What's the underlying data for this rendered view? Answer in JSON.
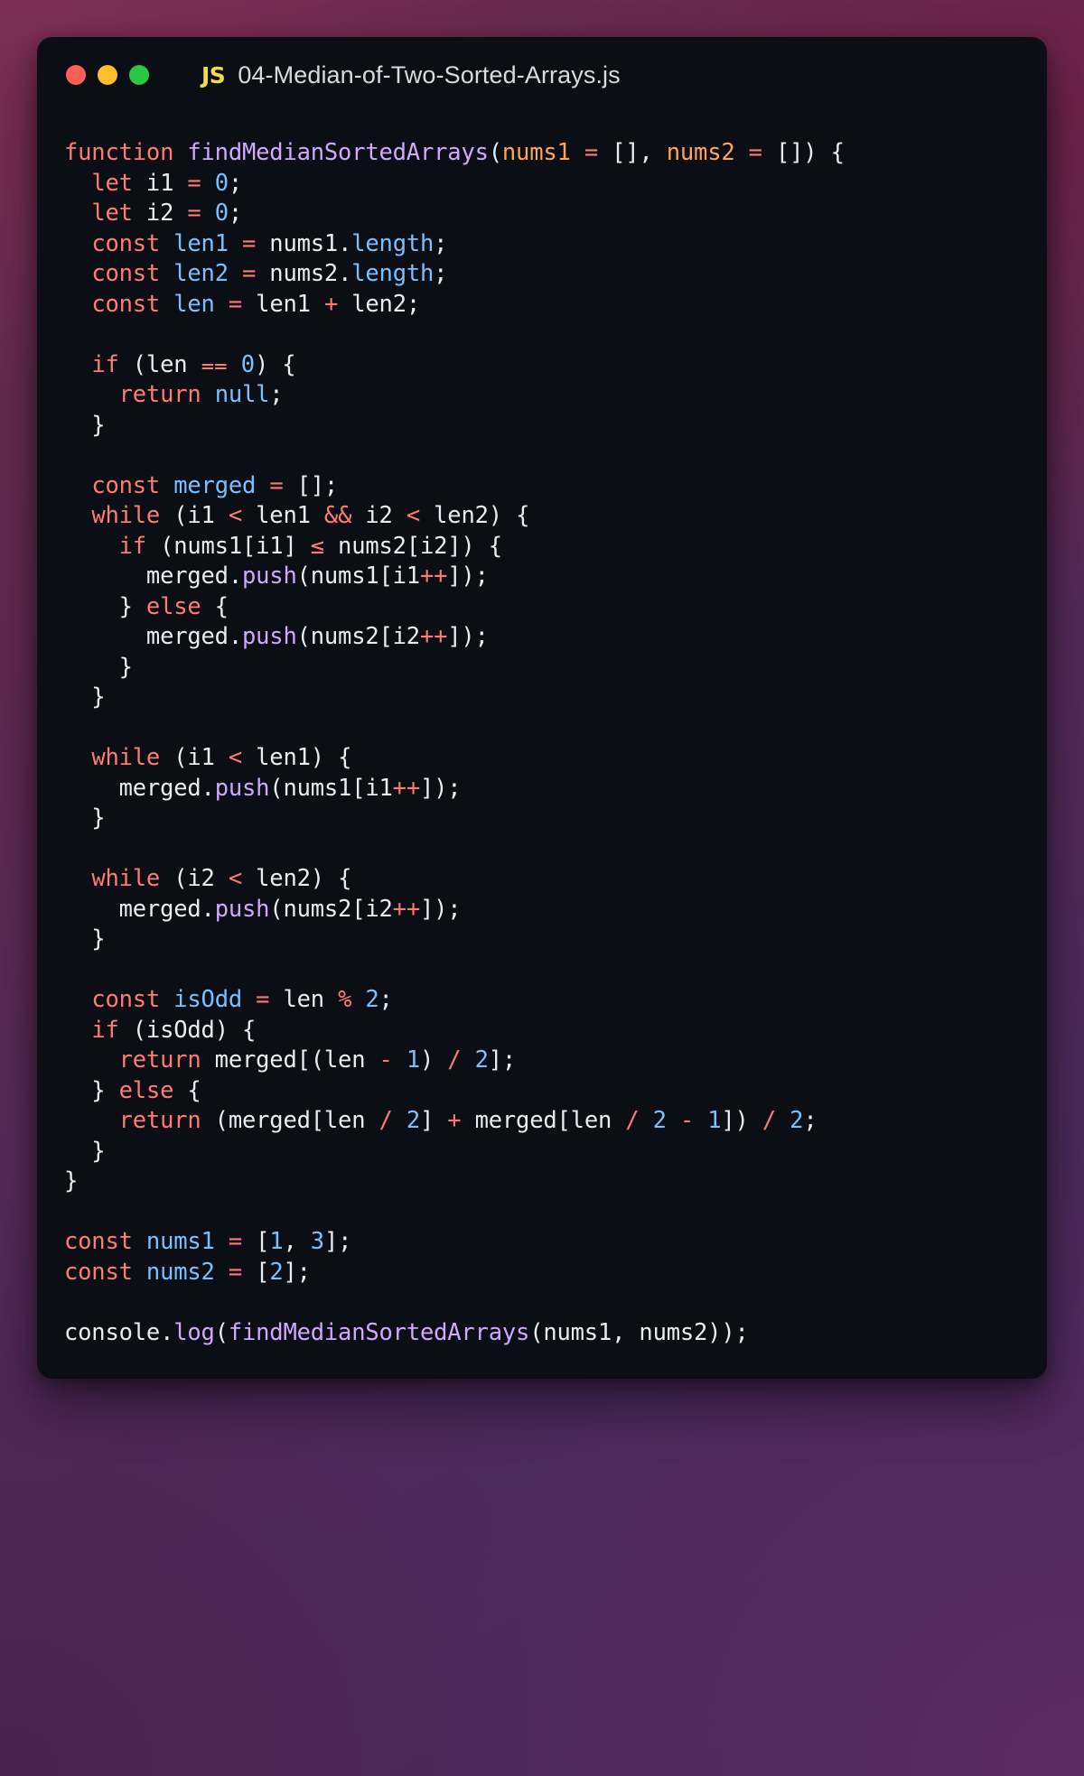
{
  "window": {
    "title": "04-Median-of-Two-Sorted-Arrays.js",
    "language_badge": "JS",
    "traffic_lights": [
      {
        "name": "close",
        "color": "#ff5f57"
      },
      {
        "name": "minimize",
        "color": "#febc2e"
      },
      {
        "name": "maximize",
        "color": "#28c840"
      }
    ]
  },
  "theme": {
    "background_card": "#0b0e14",
    "keyword": "#ff7b72",
    "function": "#d2a8ff",
    "variable": "#79c0ff",
    "parameter": "#ffa657",
    "number": "#79c0ff",
    "operator": "#ff7b72",
    "plain": "#e6edf3",
    "title_text": "#d7dae0",
    "js_badge": "#f0db4f"
  },
  "code": {
    "language": "javascript",
    "plain_text": "function findMedianSortedArrays(nums1 = [], nums2 = []) {\n  let i1 = 0;\n  let i2 = 0;\n  const len1 = nums1.length;\n  const len2 = nums2.length;\n  const len = len1 + len2;\n\n  if (len === 0) {\n    return null;\n  }\n\n  const merged = [];\n  while (i1 < len1 && i2 < len2) {\n    if (nums1[i1] <= nums2[i2]) {\n      merged.push(nums1[i1++]);\n    } else {\n      merged.push(nums2[i2++]);\n    }\n  }\n\n  while (i1 < len1) {\n    merged.push(nums1[i1++]);\n  }\n\n  while (i2 < len2) {\n    merged.push(nums2[i2++]);\n  }\n\n  const isOdd = len % 2;\n  if (isOdd) {\n    return merged[(len - 1) / 2];\n  } else {\n    return (merged[len / 2] + merged[len / 2 - 1]) / 2;\n  }\n}\n\nconst nums1 = [1, 3];\nconst nums2 = [2];\n\nconsole.log(findMedianSortedArrays(nums1, nums2));",
    "lines": [
      {
        "n": 1,
        "tokens": [
          {
            "t": "function",
            "c": "kw"
          },
          {
            "t": " ",
            "c": "pl"
          },
          {
            "t": "findMedianSortedArrays",
            "c": "fn"
          },
          {
            "t": "(",
            "c": "pl"
          },
          {
            "t": "nums1",
            "c": "par"
          },
          {
            "t": " ",
            "c": "pl"
          },
          {
            "t": "=",
            "c": "op"
          },
          {
            "t": " [], ",
            "c": "pl"
          },
          {
            "t": "nums2",
            "c": "par"
          },
          {
            "t": " ",
            "c": "pl"
          },
          {
            "t": "=",
            "c": "op"
          },
          {
            "t": " []) {",
            "c": "pl"
          }
        ]
      },
      {
        "n": 2,
        "tokens": [
          {
            "t": "  ",
            "c": "pl"
          },
          {
            "t": "let",
            "c": "kw"
          },
          {
            "t": " i1 ",
            "c": "pl"
          },
          {
            "t": "=",
            "c": "op"
          },
          {
            "t": " ",
            "c": "pl"
          },
          {
            "t": "0",
            "c": "num"
          },
          {
            "t": ";",
            "c": "pl"
          }
        ]
      },
      {
        "n": 3,
        "tokens": [
          {
            "t": "  ",
            "c": "pl"
          },
          {
            "t": "let",
            "c": "kw"
          },
          {
            "t": " i2 ",
            "c": "pl"
          },
          {
            "t": "=",
            "c": "op"
          },
          {
            "t": " ",
            "c": "pl"
          },
          {
            "t": "0",
            "c": "num"
          },
          {
            "t": ";",
            "c": "pl"
          }
        ]
      },
      {
        "n": 4,
        "tokens": [
          {
            "t": "  ",
            "c": "pl"
          },
          {
            "t": "const",
            "c": "kw"
          },
          {
            "t": " ",
            "c": "pl"
          },
          {
            "t": "len1",
            "c": "var"
          },
          {
            "t": " ",
            "c": "pl"
          },
          {
            "t": "=",
            "c": "op"
          },
          {
            "t": " nums1.",
            "c": "pl"
          },
          {
            "t": "length",
            "c": "var"
          },
          {
            "t": ";",
            "c": "pl"
          }
        ]
      },
      {
        "n": 5,
        "tokens": [
          {
            "t": "  ",
            "c": "pl"
          },
          {
            "t": "const",
            "c": "kw"
          },
          {
            "t": " ",
            "c": "pl"
          },
          {
            "t": "len2",
            "c": "var"
          },
          {
            "t": " ",
            "c": "pl"
          },
          {
            "t": "=",
            "c": "op"
          },
          {
            "t": " nums2.",
            "c": "pl"
          },
          {
            "t": "length",
            "c": "var"
          },
          {
            "t": ";",
            "c": "pl"
          }
        ]
      },
      {
        "n": 6,
        "tokens": [
          {
            "t": "  ",
            "c": "pl"
          },
          {
            "t": "const",
            "c": "kw"
          },
          {
            "t": " ",
            "c": "pl"
          },
          {
            "t": "len",
            "c": "var"
          },
          {
            "t": " ",
            "c": "pl"
          },
          {
            "t": "=",
            "c": "op"
          },
          {
            "t": " len1 ",
            "c": "pl"
          },
          {
            "t": "+",
            "c": "op"
          },
          {
            "t": " len2;",
            "c": "pl"
          }
        ]
      },
      {
        "n": 7,
        "tokens": []
      },
      {
        "n": 8,
        "tokens": [
          {
            "t": "  ",
            "c": "pl"
          },
          {
            "t": "if",
            "c": "kw"
          },
          {
            "t": " (len ",
            "c": "pl"
          },
          {
            "t": "⩵",
            "c": "op"
          },
          {
            "t": " ",
            "c": "pl"
          },
          {
            "t": "0",
            "c": "num"
          },
          {
            "t": ") {",
            "c": "pl"
          }
        ]
      },
      {
        "n": 9,
        "tokens": [
          {
            "t": "    ",
            "c": "pl"
          },
          {
            "t": "return",
            "c": "kw"
          },
          {
            "t": " ",
            "c": "pl"
          },
          {
            "t": "null",
            "c": "num"
          },
          {
            "t": ";",
            "c": "pl"
          }
        ]
      },
      {
        "n": 10,
        "tokens": [
          {
            "t": "  }",
            "c": "pl"
          }
        ]
      },
      {
        "n": 11,
        "tokens": []
      },
      {
        "n": 12,
        "tokens": [
          {
            "t": "  ",
            "c": "pl"
          },
          {
            "t": "const",
            "c": "kw"
          },
          {
            "t": " ",
            "c": "pl"
          },
          {
            "t": "merged",
            "c": "var"
          },
          {
            "t": " ",
            "c": "pl"
          },
          {
            "t": "=",
            "c": "op"
          },
          {
            "t": " [];",
            "c": "pl"
          }
        ]
      },
      {
        "n": 13,
        "tokens": [
          {
            "t": "  ",
            "c": "pl"
          },
          {
            "t": "while",
            "c": "kw"
          },
          {
            "t": " (i1 ",
            "c": "pl"
          },
          {
            "t": "<",
            "c": "op"
          },
          {
            "t": " len1 ",
            "c": "pl"
          },
          {
            "t": "&&",
            "c": "op"
          },
          {
            "t": " i2 ",
            "c": "pl"
          },
          {
            "t": "<",
            "c": "op"
          },
          {
            "t": " len2) {",
            "c": "pl"
          }
        ]
      },
      {
        "n": 14,
        "tokens": [
          {
            "t": "    ",
            "c": "pl"
          },
          {
            "t": "if",
            "c": "kw"
          },
          {
            "t": " (nums1[i1] ",
            "c": "pl"
          },
          {
            "t": "≤",
            "c": "op"
          },
          {
            "t": " nums2[i2]) {",
            "c": "pl"
          }
        ]
      },
      {
        "n": 15,
        "tokens": [
          {
            "t": "      merged.",
            "c": "pl"
          },
          {
            "t": "push",
            "c": "fn"
          },
          {
            "t": "(nums1[i1",
            "c": "pl"
          },
          {
            "t": "++",
            "c": "op"
          },
          {
            "t": "]);",
            "c": "pl"
          }
        ]
      },
      {
        "n": 16,
        "tokens": [
          {
            "t": "    } ",
            "c": "pl"
          },
          {
            "t": "else",
            "c": "kw"
          },
          {
            "t": " {",
            "c": "pl"
          }
        ]
      },
      {
        "n": 17,
        "tokens": [
          {
            "t": "      merged.",
            "c": "pl"
          },
          {
            "t": "push",
            "c": "fn"
          },
          {
            "t": "(nums2[i2",
            "c": "pl"
          },
          {
            "t": "++",
            "c": "op"
          },
          {
            "t": "]);",
            "c": "pl"
          }
        ]
      },
      {
        "n": 18,
        "tokens": [
          {
            "t": "    }",
            "c": "pl"
          }
        ]
      },
      {
        "n": 19,
        "tokens": [
          {
            "t": "  }",
            "c": "pl"
          }
        ]
      },
      {
        "n": 20,
        "tokens": []
      },
      {
        "n": 21,
        "tokens": [
          {
            "t": "  ",
            "c": "pl"
          },
          {
            "t": "while",
            "c": "kw"
          },
          {
            "t": " (i1 ",
            "c": "pl"
          },
          {
            "t": "<",
            "c": "op"
          },
          {
            "t": " len1) {",
            "c": "pl"
          }
        ]
      },
      {
        "n": 22,
        "tokens": [
          {
            "t": "    merged.",
            "c": "pl"
          },
          {
            "t": "push",
            "c": "fn"
          },
          {
            "t": "(nums1[i1",
            "c": "pl"
          },
          {
            "t": "++",
            "c": "op"
          },
          {
            "t": "]);",
            "c": "pl"
          }
        ]
      },
      {
        "n": 23,
        "tokens": [
          {
            "t": "  }",
            "c": "pl"
          }
        ]
      },
      {
        "n": 24,
        "tokens": []
      },
      {
        "n": 25,
        "tokens": [
          {
            "t": "  ",
            "c": "pl"
          },
          {
            "t": "while",
            "c": "kw"
          },
          {
            "t": " (i2 ",
            "c": "pl"
          },
          {
            "t": "<",
            "c": "op"
          },
          {
            "t": " len2) {",
            "c": "pl"
          }
        ]
      },
      {
        "n": 26,
        "tokens": [
          {
            "t": "    merged.",
            "c": "pl"
          },
          {
            "t": "push",
            "c": "fn"
          },
          {
            "t": "(nums2[i2",
            "c": "pl"
          },
          {
            "t": "++",
            "c": "op"
          },
          {
            "t": "]);",
            "c": "pl"
          }
        ]
      },
      {
        "n": 27,
        "tokens": [
          {
            "t": "  }",
            "c": "pl"
          }
        ]
      },
      {
        "n": 28,
        "tokens": []
      },
      {
        "n": 29,
        "tokens": [
          {
            "t": "  ",
            "c": "pl"
          },
          {
            "t": "const",
            "c": "kw"
          },
          {
            "t": " ",
            "c": "pl"
          },
          {
            "t": "isOdd",
            "c": "var"
          },
          {
            "t": " ",
            "c": "pl"
          },
          {
            "t": "=",
            "c": "op"
          },
          {
            "t": " len ",
            "c": "pl"
          },
          {
            "t": "%",
            "c": "op"
          },
          {
            "t": " ",
            "c": "pl"
          },
          {
            "t": "2",
            "c": "num"
          },
          {
            "t": ";",
            "c": "pl"
          }
        ]
      },
      {
        "n": 30,
        "tokens": [
          {
            "t": "  ",
            "c": "pl"
          },
          {
            "t": "if",
            "c": "kw"
          },
          {
            "t": " (isOdd) {",
            "c": "pl"
          }
        ]
      },
      {
        "n": 31,
        "tokens": [
          {
            "t": "    ",
            "c": "pl"
          },
          {
            "t": "return",
            "c": "kw"
          },
          {
            "t": " merged[(len ",
            "c": "pl"
          },
          {
            "t": "-",
            "c": "op"
          },
          {
            "t": " ",
            "c": "pl"
          },
          {
            "t": "1",
            "c": "num"
          },
          {
            "t": ") ",
            "c": "pl"
          },
          {
            "t": "/",
            "c": "op"
          },
          {
            "t": " ",
            "c": "pl"
          },
          {
            "t": "2",
            "c": "num"
          },
          {
            "t": "];",
            "c": "pl"
          }
        ]
      },
      {
        "n": 32,
        "tokens": [
          {
            "t": "  } ",
            "c": "pl"
          },
          {
            "t": "else",
            "c": "kw"
          },
          {
            "t": " {",
            "c": "pl"
          }
        ]
      },
      {
        "n": 33,
        "tokens": [
          {
            "t": "    ",
            "c": "pl"
          },
          {
            "t": "return",
            "c": "kw"
          },
          {
            "t": " (merged[len ",
            "c": "pl"
          },
          {
            "t": "/",
            "c": "op"
          },
          {
            "t": " ",
            "c": "pl"
          },
          {
            "t": "2",
            "c": "num"
          },
          {
            "t": "] ",
            "c": "pl"
          },
          {
            "t": "+",
            "c": "op"
          },
          {
            "t": " merged[len ",
            "c": "pl"
          },
          {
            "t": "/",
            "c": "op"
          },
          {
            "t": " ",
            "c": "pl"
          },
          {
            "t": "2",
            "c": "num"
          },
          {
            "t": " ",
            "c": "pl"
          },
          {
            "t": "-",
            "c": "op"
          },
          {
            "t": " ",
            "c": "pl"
          },
          {
            "t": "1",
            "c": "num"
          },
          {
            "t": "]) ",
            "c": "pl"
          },
          {
            "t": "/",
            "c": "op"
          },
          {
            "t": " ",
            "c": "pl"
          },
          {
            "t": "2",
            "c": "num"
          },
          {
            "t": ";",
            "c": "pl"
          }
        ]
      },
      {
        "n": 34,
        "tokens": [
          {
            "t": "  }",
            "c": "pl"
          }
        ]
      },
      {
        "n": 35,
        "tokens": [
          {
            "t": "}",
            "c": "pl"
          }
        ]
      },
      {
        "n": 36,
        "tokens": []
      },
      {
        "n": 37,
        "tokens": [
          {
            "t": "const",
            "c": "kw"
          },
          {
            "t": " ",
            "c": "pl"
          },
          {
            "t": "nums1",
            "c": "var"
          },
          {
            "t": " ",
            "c": "pl"
          },
          {
            "t": "=",
            "c": "op"
          },
          {
            "t": " [",
            "c": "pl"
          },
          {
            "t": "1",
            "c": "num"
          },
          {
            "t": ", ",
            "c": "pl"
          },
          {
            "t": "3",
            "c": "num"
          },
          {
            "t": "];",
            "c": "pl"
          }
        ]
      },
      {
        "n": 38,
        "tokens": [
          {
            "t": "const",
            "c": "kw"
          },
          {
            "t": " ",
            "c": "pl"
          },
          {
            "t": "nums2",
            "c": "var"
          },
          {
            "t": " ",
            "c": "pl"
          },
          {
            "t": "=",
            "c": "op"
          },
          {
            "t": " [",
            "c": "pl"
          },
          {
            "t": "2",
            "c": "num"
          },
          {
            "t": "];",
            "c": "pl"
          }
        ]
      },
      {
        "n": 39,
        "tokens": []
      },
      {
        "n": 40,
        "tokens": [
          {
            "t": "console.",
            "c": "pl"
          },
          {
            "t": "log",
            "c": "fn"
          },
          {
            "t": "(",
            "c": "pl"
          },
          {
            "t": "findMedianSortedArrays",
            "c": "fn"
          },
          {
            "t": "(nums1, nums2));",
            "c": "pl"
          }
        ]
      }
    ]
  }
}
